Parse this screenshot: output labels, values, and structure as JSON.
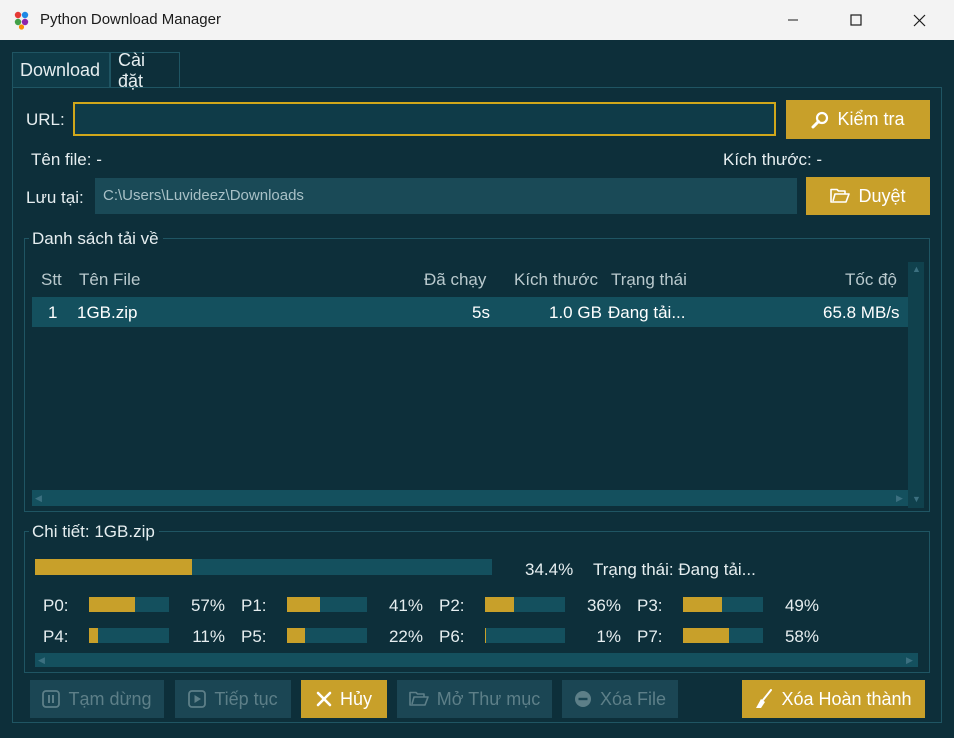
{
  "window": {
    "title": "Python Download Manager"
  },
  "tabs": [
    {
      "label": "Download"
    },
    {
      "label": "Cài đặt"
    }
  ],
  "form": {
    "url_label": "URL:",
    "url_value": "",
    "check_button": "Kiểm tra",
    "filename_label": "Tên file: -",
    "size_label": "Kích thước: -",
    "save_label": "Lưu tại:",
    "save_path": "C:\\Users\\Luvideez\\Downloads",
    "browse_button": "Duyệt"
  },
  "downloads": {
    "group_title": "Danh sách tải về",
    "columns": [
      "Stt",
      "Tên File",
      "Đã chạy",
      "Kích thước",
      "Trạng thái",
      "Tốc độ"
    ],
    "rows": [
      {
        "stt": "1",
        "name": "1GB.zip",
        "elapsed": "5s",
        "size": "1.0 GB",
        "status": "Đang tải...",
        "speed": "65.8 MB/s"
      }
    ]
  },
  "details": {
    "group_title": "Chi tiết: 1GB.zip",
    "overall_percent": 34.4,
    "overall_text": "34.4%",
    "status_text": "Trạng thái: Đang tải...",
    "parts": [
      {
        "label": "P0:",
        "percent": 57,
        "text": "57%"
      },
      {
        "label": "P1:",
        "percent": 41,
        "text": "41%"
      },
      {
        "label": "P2:",
        "percent": 36,
        "text": "36%"
      },
      {
        "label": "P3:",
        "percent": 49,
        "text": "49%"
      },
      {
        "label": "P4:",
        "percent": 11,
        "text": "11%"
      },
      {
        "label": "P5:",
        "percent": 22,
        "text": "22%"
      },
      {
        "label": "P6:",
        "percent": 1,
        "text": "1%"
      },
      {
        "label": "P7:",
        "percent": 58,
        "text": "58%"
      }
    ]
  },
  "actions": {
    "pause": "Tạm dừng",
    "resume": "Tiếp tục",
    "cancel": "Hủy",
    "open_folder": "Mở Thư mục",
    "delete_file": "Xóa File",
    "clear_completed": "Xóa Hoàn thành"
  },
  "colors": {
    "accent": "#c8a02a",
    "background": "#0d2f3a",
    "row_selected": "#14505e"
  },
  "icons": [
    "app-icon",
    "minimize-icon",
    "maximize-icon",
    "close-icon",
    "search-icon",
    "folder-icon",
    "pause-icon",
    "play-icon",
    "x-icon",
    "folder-icon",
    "minus-circle-icon",
    "broom-icon"
  ]
}
